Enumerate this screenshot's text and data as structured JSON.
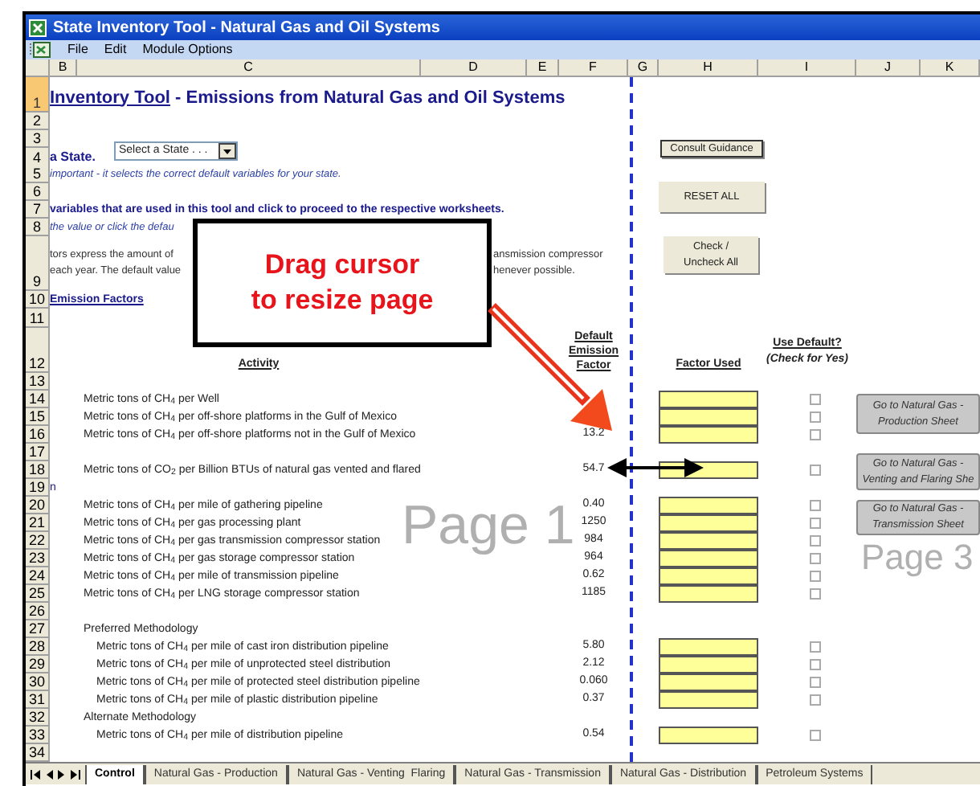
{
  "window": {
    "title": "State Inventory Tool - Natural Gas and Oil Systems"
  },
  "menu": [
    "File",
    "Edit",
    "Module Options"
  ],
  "columns": [
    "B",
    "C",
    "D",
    "E",
    "F",
    "G",
    "H",
    "I",
    "J",
    "K"
  ],
  "rows": [
    {
      "number": "1",
      "selected": true,
      "title": {
        "link": "Inventory Tool",
        "text": " - Emissions from Natural Gas and Oil Systems"
      }
    },
    {
      "number": "2",
      "selected": false
    },
    {
      "number": "3",
      "selected": false
    },
    {
      "number": "4",
      "selected": false,
      "label": "a State."
    },
    {
      "number": "5",
      "selected": false,
      "note": "important - it selects the correct default variables for your state."
    },
    {
      "number": "6",
      "selected": false
    },
    {
      "number": "7",
      "selected": false,
      "instruction": "variables that are used in this tool and click to proceed to the respective worksheets."
    },
    {
      "number": "8",
      "selected": false,
      "note": "the value or click the defau"
    },
    {
      "number": "9",
      "selected": false,
      "paragraph_left": [
        "tors express the amount of",
        "each year. The default value"
      ],
      "paragraph_right": [
        "ansmission compressor",
        "henever possible."
      ]
    },
    {
      "number": "10",
      "selected": false,
      "link": "Emission Factors"
    },
    {
      "number": "11",
      "selected": false
    },
    {
      "number": "12",
      "selected": false,
      "headers": {
        "activity": "Activity",
        "default": [
          "Default",
          "Emission",
          "Factor"
        ],
        "factor_used": "Factor Used",
        "use_default": [
          "Use Default?",
          "(Check for Yes)"
        ]
      }
    },
    {
      "number": "13",
      "selected": false
    },
    {
      "number": "14",
      "selected": false,
      "activity": {
        "kind": "activity",
        "text": "Metric tons of CH$_{4}$ per Well"
      },
      "factor_input": true,
      "checkbox": {
        "checked": false
      }
    },
    {
      "number": "15",
      "selected": false,
      "activity": {
        "kind": "activity",
        "text": "Metric tons of CH$_{4}$ per off-shore platforms in the Gulf of Mexico"
      },
      "factor_input": true,
      "checkbox": {
        "checked": false
      }
    },
    {
      "number": "16",
      "selected": false,
      "activity": {
        "kind": "activity",
        "text": "Metric tons of CH$_{4}$ per off-shore platforms not in the Gulf of Mexico"
      },
      "default_value": "13.2",
      "factor_input": true,
      "checkbox": {
        "checked": false
      }
    },
    {
      "number": "17",
      "selected": false
    },
    {
      "number": "18",
      "selected": false,
      "activity": {
        "kind": "activity",
        "text": "Metric tons of CO$_{2}$ per Billion BTUs of natural gas vented and flared"
      },
      "default_value": "54.7",
      "factor_input": true,
      "checkbox": {
        "checked": false
      }
    },
    {
      "number": "19",
      "selected": false,
      "fragment": "n"
    },
    {
      "number": "20",
      "selected": false,
      "activity": {
        "kind": "activity",
        "text": "Metric tons of CH$_{4}$ per mile of gathering pipeline"
      },
      "default_value": "0.40",
      "factor_input": true,
      "checkbox": {
        "checked": false
      }
    },
    {
      "number": "21",
      "selected": false,
      "activity": {
        "kind": "activity",
        "text": "Metric tons of CH$_{4}$ per gas processing plant"
      },
      "default_value": "1250",
      "factor_input": true,
      "checkbox": {
        "checked": false
      }
    },
    {
      "number": "22",
      "selected": false,
      "activity": {
        "kind": "activity",
        "text": "Metric tons of CH$_{4}$ per gas transmission compressor station"
      },
      "default_value": "984",
      "factor_input": true,
      "checkbox": {
        "checked": false
      }
    },
    {
      "number": "23",
      "selected": false,
      "activity": {
        "kind": "activity",
        "text": "Metric tons of CH$_{4}$ per gas storage compressor station"
      },
      "default_value": "964",
      "factor_input": true,
      "checkbox": {
        "checked": false
      }
    },
    {
      "number": "24",
      "selected": false,
      "activity": {
        "kind": "activity",
        "text": "Metric tons of CH$_{4}$ per mile of transmission pipeline"
      },
      "default_value": "0.62",
      "factor_input": true,
      "checkbox": {
        "checked": false
      }
    },
    {
      "number": "25",
      "selected": false,
      "activity": {
        "kind": "activity",
        "text": "Metric tons of CH$_{4}$ per LNG storage compressor station"
      },
      "default_value": "1185",
      "factor_input": true,
      "checkbox": {
        "checked": false
      }
    },
    {
      "number": "26",
      "selected": false
    },
    {
      "number": "27",
      "selected": false,
      "activity": {
        "kind": "section",
        "text": "Preferred Methodology"
      }
    },
    {
      "number": "28",
      "selected": false,
      "activity": {
        "kind": "sub_activity",
        "text": "Metric tons of CH$_{4}$ per mile of cast iron distribution pipeline"
      },
      "default_value": "5.80",
      "factor_input": true,
      "checkbox": {
        "checked": false
      }
    },
    {
      "number": "29",
      "selected": false,
      "activity": {
        "kind": "sub_activity",
        "text": "Metric tons of CH$_{4}$ per mile of unprotected steel distribution"
      },
      "default_value": "2.12",
      "factor_input": true,
      "checkbox": {
        "checked": false
      }
    },
    {
      "number": "30",
      "selected": false,
      "activity": {
        "kind": "sub_activity",
        "text": "Metric tons of CH$_{4}$ per mile of protected steel distribution pipeline"
      },
      "default_value": "0.060",
      "factor_input": true,
      "checkbox": {
        "checked": false
      }
    },
    {
      "number": "31",
      "selected": false,
      "activity": {
        "kind": "sub_activity",
        "text": "Metric tons of CH$_{4}$ per mile of plastic distribution pipeline"
      },
      "default_value": "0.37",
      "factor_input": true,
      "checkbox": {
        "checked": false
      }
    },
    {
      "number": "32",
      "selected": false,
      "activity": {
        "kind": "section",
        "text": "Alternate Methodology"
      }
    },
    {
      "number": "33",
      "selected": false,
      "activity": {
        "kind": "sub_activity",
        "text": "Metric tons of CH$_{4}$ per mile of distribution pipeline"
      },
      "default_value": "0.54",
      "factor_input": true,
      "checkbox": {
        "checked": false
      }
    },
    {
      "number": "34",
      "selected": false
    }
  ],
  "dropdown": {
    "value": "Select a State . . ."
  },
  "buttons": [
    {
      "kind": "command",
      "focused": true,
      "label": [
        "Consult Guidance"
      ]
    },
    {
      "kind": "command",
      "focused": false,
      "label": [
        "RESET ALL"
      ]
    },
    {
      "kind": "command",
      "focused": false,
      "label": [
        "Check /",
        "Uncheck All"
      ]
    },
    {
      "kind": "navigation",
      "focused": false,
      "label": [
        "Go to Natural Gas -",
        "Production Sheet"
      ]
    },
    {
      "kind": "navigation",
      "focused": false,
      "label": [
        "Go to Natural Gas -",
        "Venting and Flaring She"
      ]
    },
    {
      "kind": "navigation",
      "focused": false,
      "label": [
        "Go to Natural Gas -",
        "Transmission Sheet"
      ]
    }
  ],
  "page_labels": [
    "Page 1",
    "Page 3"
  ],
  "callout": {
    "lines": [
      "Drag cursor",
      "to resize page"
    ]
  },
  "sheet_tabs": [
    {
      "label": "Control",
      "selected": true
    },
    {
      "label": "Natural Gas - Production",
      "selected": false
    },
    {
      "label": "Natural Gas - Venting  Flaring",
      "selected": false
    },
    {
      "label": "Natural Gas - Transmission",
      "selected": false
    },
    {
      "label": "Natural Gas - Distribution",
      "selected": false
    },
    {
      "label": "Petroleum Systems",
      "selected": false
    }
  ]
}
